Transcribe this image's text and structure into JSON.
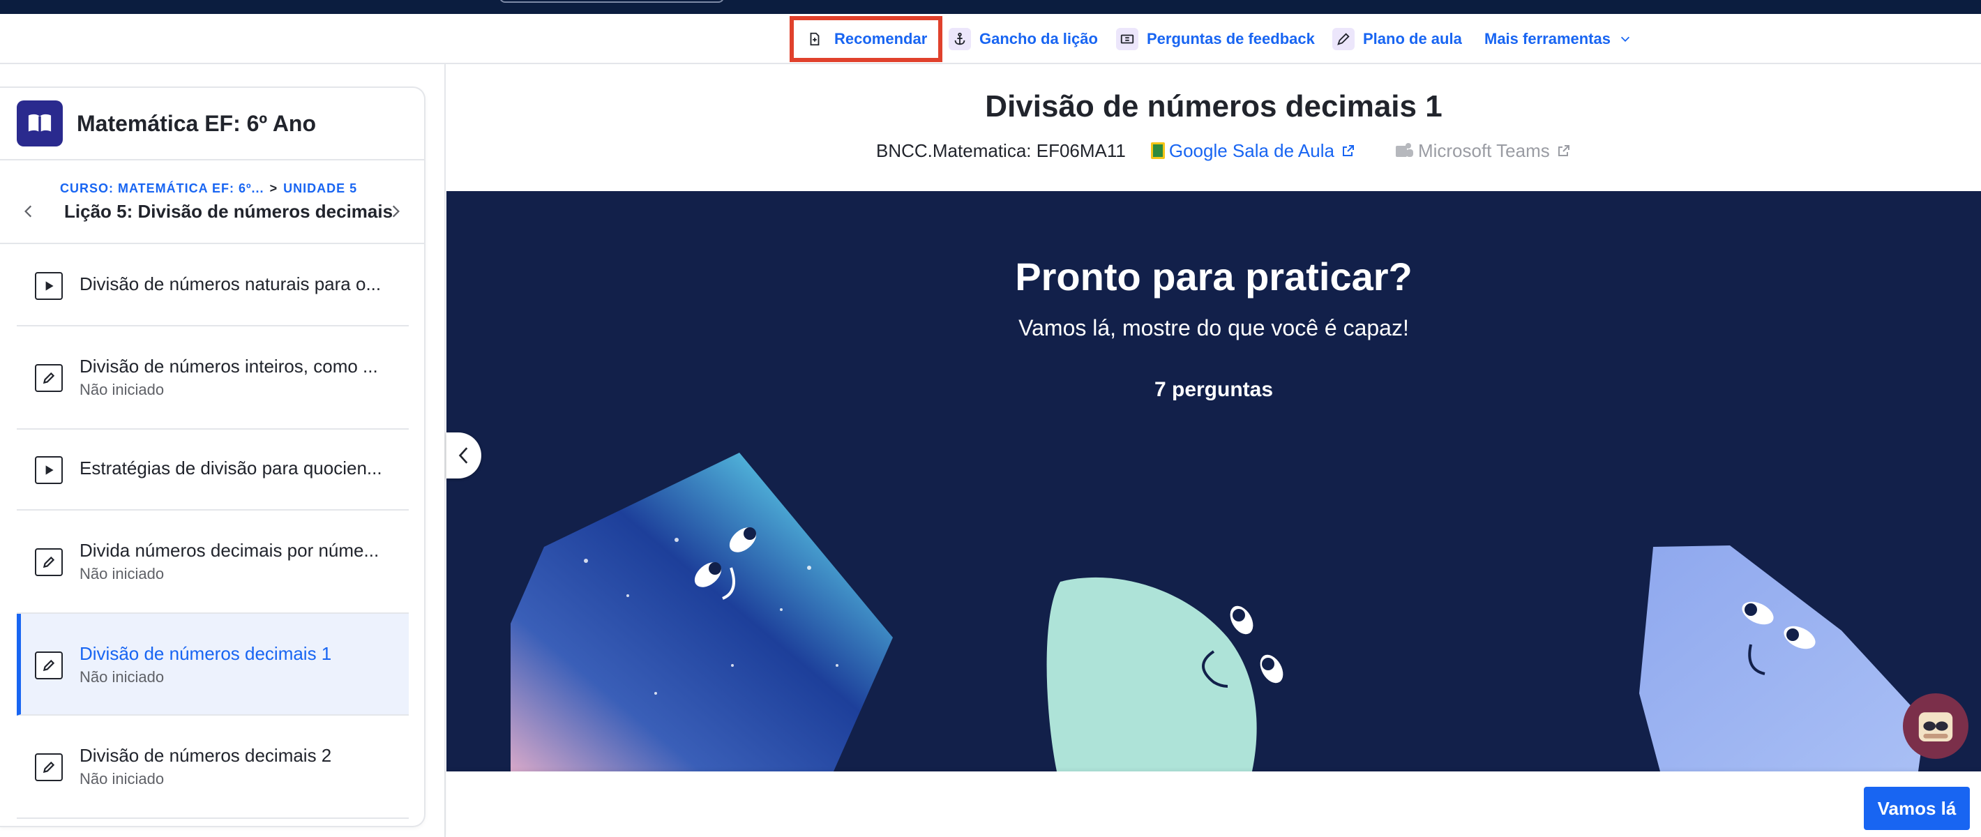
{
  "toolbar": {
    "recommend": "Recomendar",
    "hook": "Gancho da lição",
    "feedback": "Perguntas de feedback",
    "plan": "Plano de aula",
    "more": "Mais ferramentas"
  },
  "sidebar": {
    "course_title": "Matemática EF: 6º Ano",
    "crumb_course": "CURSO: MATEMÁTICA EF: 6º...",
    "crumb_sep": ">",
    "crumb_unit": "UNIDADE 5",
    "lesson_title": "Lição 5: Divisão de números decimais",
    "items": [
      {
        "title": "Divisão de números naturais para o...",
        "status": "",
        "kind": "video"
      },
      {
        "title": "Divisão de números inteiros, como ...",
        "status": "Não iniciado",
        "kind": "exercise"
      },
      {
        "title": "Estratégias de divisão para quocien...",
        "status": "",
        "kind": "video"
      },
      {
        "title": "Divida números decimais por núme...",
        "status": "Não iniciado",
        "kind": "exercise"
      },
      {
        "title": "Divisão de números decimais 1",
        "status": "Não iniciado",
        "kind": "exercise",
        "active": true
      },
      {
        "title": "Divisão de números decimais 2",
        "status": "Não iniciado",
        "kind": "exercise"
      }
    ]
  },
  "main": {
    "title": "Divisão de números decimais 1",
    "standard": "BNCC.Matematica: EF06MA11",
    "google_classroom": "Google Sala de Aula",
    "ms_teams": "Microsoft Teams",
    "stage_title": "Pronto para praticar?",
    "stage_subtitle": "Vamos lá, mostre do que você é capaz!",
    "question_count": "7 perguntas",
    "go_button": "Vamos lá"
  },
  "colors": {
    "accent": "#1865f2",
    "navy": "#12204a",
    "highlight": "#e0412c"
  }
}
